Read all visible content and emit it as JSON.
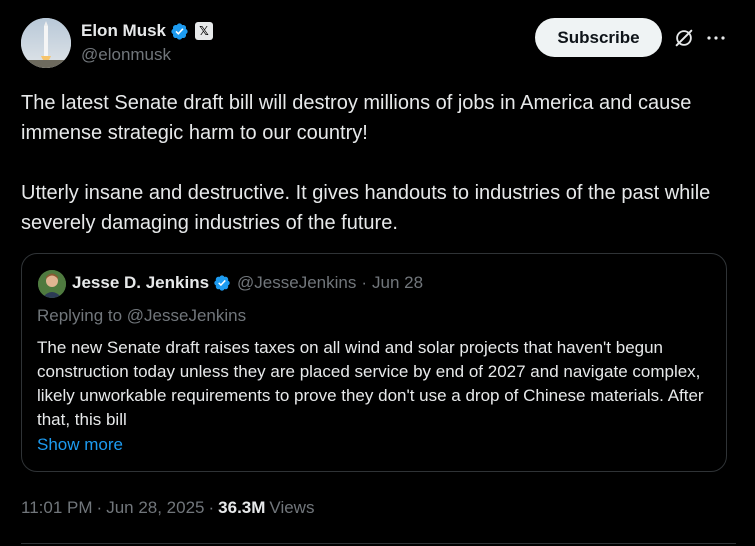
{
  "author": {
    "name": "Elon Musk",
    "handle": "@elonmusk",
    "badge_letter": "𝕏"
  },
  "actions": {
    "subscribe_label": "Subscribe",
    "grok_icon": "grok-icon",
    "more_icon": "more-icon"
  },
  "tweet": {
    "paragraph1": "The latest Senate draft bill will destroy millions of jobs in America and cause immense strategic harm to our country!",
    "paragraph2": "Utterly insane and destructive. It gives handouts to industries of the past while severely damaging industries of the future."
  },
  "quote": {
    "name": "Jesse D. Jenkins",
    "handle": "@JesseJenkins",
    "separator": "·",
    "date": "Jun 28",
    "replying_to": "Replying to @JesseJenkins",
    "text": "The new Senate draft raises taxes on all wind and solar projects that haven't begun construction today unless they are placed service by end of 2027 and navigate complex, likely unworkable requirements to prove they don't use a drop of Chinese materials. After that, this bill",
    "show_more": "Show more"
  },
  "meta": {
    "time": "11:01 PM",
    "separator": "·",
    "date": "Jun 28, 2025",
    "views_count": "36.3M",
    "views_label": "Views"
  },
  "colors": {
    "background": "#000000",
    "text": "#e7e9ea",
    "secondary": "#71767b",
    "link": "#1d9bf0",
    "verified": "#1d9bf0",
    "border": "#2f3336"
  }
}
